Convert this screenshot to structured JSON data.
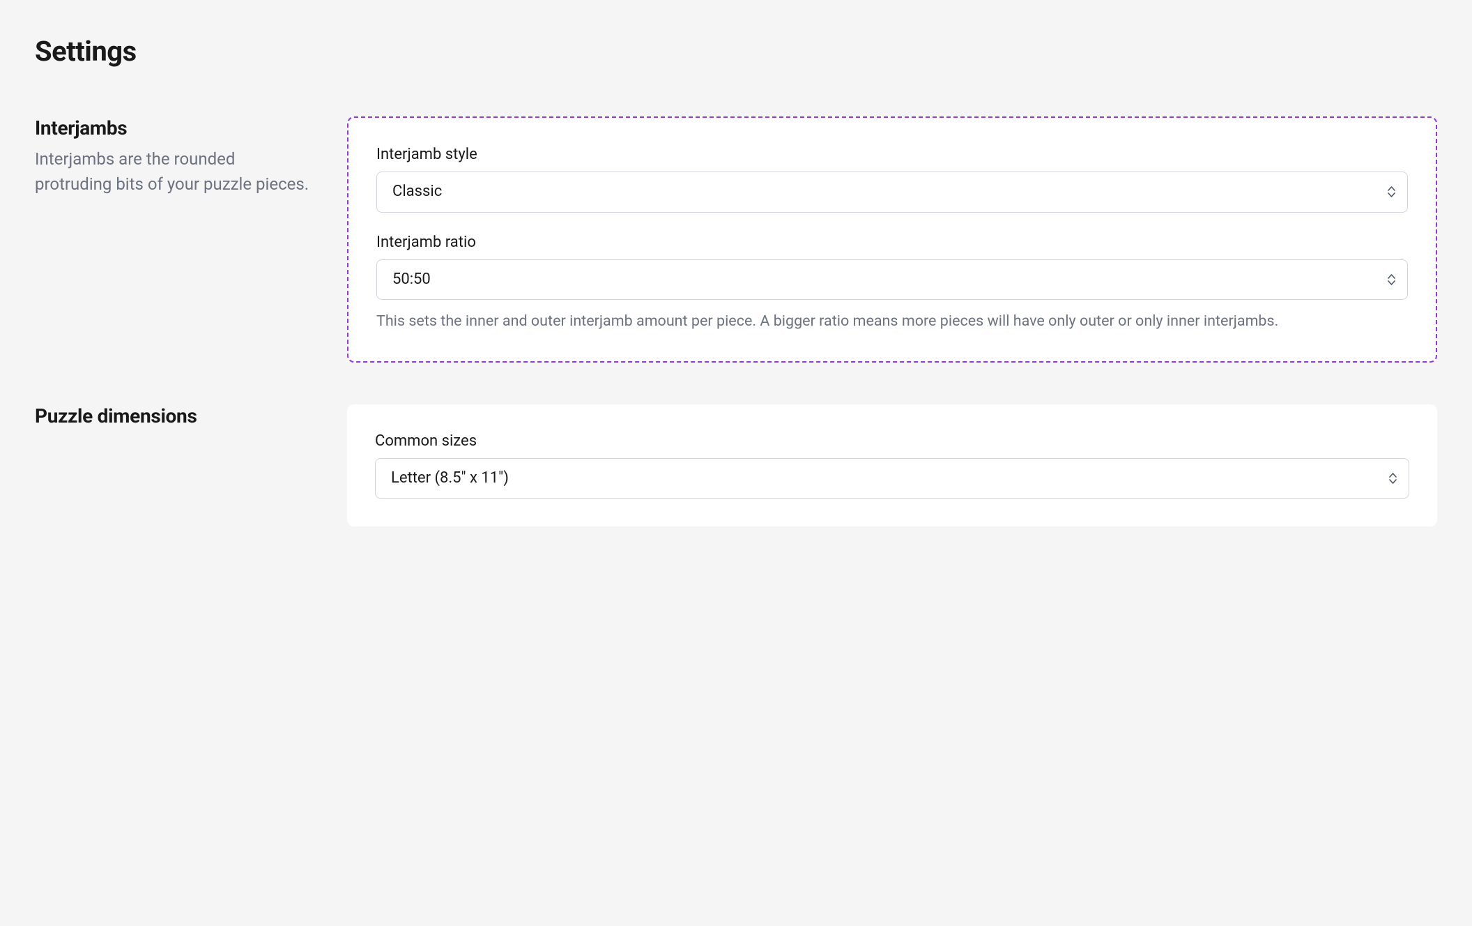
{
  "page": {
    "title": "Settings"
  },
  "sections": {
    "interjambs": {
      "title": "Interjambs",
      "description": "Interjambs are the rounded protruding bits of your puzzle pieces.",
      "fields": {
        "style": {
          "label": "Interjamb style",
          "value": "Classic"
        },
        "ratio": {
          "label": "Interjamb ratio",
          "value": "50:50",
          "help": "This sets the inner and outer interjamb amount per piece. A bigger ratio means more pieces will have only outer or only inner interjambs."
        }
      }
    },
    "dimensions": {
      "title": "Puzzle dimensions",
      "fields": {
        "common_sizes": {
          "label": "Common sizes",
          "value": "Letter (8.5\" x 11\")"
        }
      }
    }
  }
}
